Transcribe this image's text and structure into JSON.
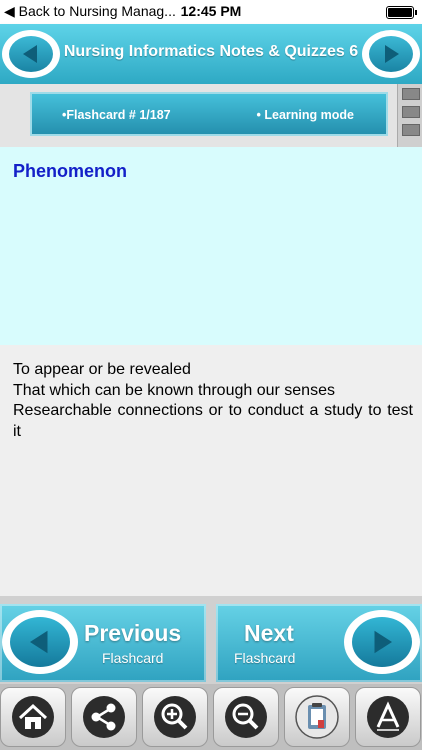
{
  "status_bar": {
    "back_label": "◀ Back to Nursing Manag...",
    "time": "12:45 PM"
  },
  "header": {
    "title": "Nursing Informatics Notes & Quizzes 6"
  },
  "flashcard_info": {
    "counter": "•Flashcard #  1/187",
    "mode": "• Learning mode"
  },
  "card": {
    "term": "Phenomenon",
    "definitions": [
      "To appear or be revealed",
      "That which can be known through our senses",
      "Researchable connections or to conduct a study to test it"
    ]
  },
  "navigation": {
    "previous": {
      "title": "Previous",
      "subtitle": "Flashcard"
    },
    "next": {
      "title": "Next",
      "subtitle": "Flashcard"
    }
  },
  "toolbar": {
    "icons": [
      "home-icon",
      "share-icon",
      "zoom-in-icon",
      "zoom-out-icon",
      "clipboard-icon",
      "font-icon"
    ]
  },
  "colors": {
    "accent": "#2ea9c4",
    "term_text": "#1420c8",
    "card_background": "#d8fcfd"
  }
}
